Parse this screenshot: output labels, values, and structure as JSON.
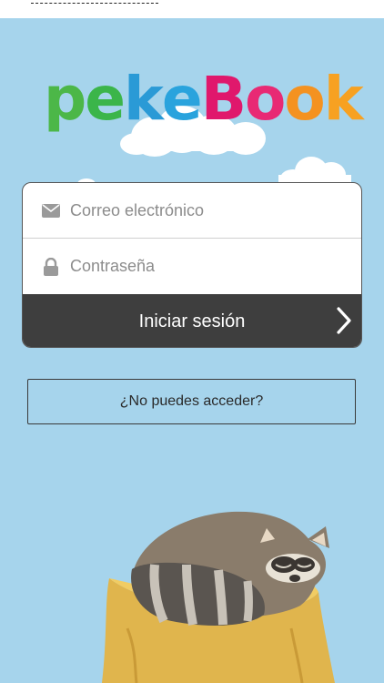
{
  "app": {
    "logo_letters": [
      {
        "ch": "p",
        "color": "#4cb748"
      },
      {
        "ch": "e",
        "color": "#3bb54a"
      },
      {
        "ch": "k",
        "color": "#2a9ad6"
      },
      {
        "ch": "e",
        "color": "#29a3dd"
      },
      {
        "ch": "B",
        "color": "#e0186c"
      },
      {
        "ch": "o",
        "color": "#e82a74"
      },
      {
        "ch": "o",
        "color": "#f49220"
      },
      {
        "ch": "k",
        "color": "#f7a121"
      }
    ]
  },
  "login": {
    "email_placeholder": "Correo electrónico",
    "password_placeholder": "Contraseña",
    "submit_label": "Iniciar sesión"
  },
  "help": {
    "label": "¿No puedes acceder?"
  },
  "theme": {
    "background": "#a6d4ec",
    "button_dark": "#3e3e3e"
  },
  "icons": {
    "email": "envelope-icon",
    "password": "lock-icon",
    "submit": "chevron-right-icon"
  }
}
